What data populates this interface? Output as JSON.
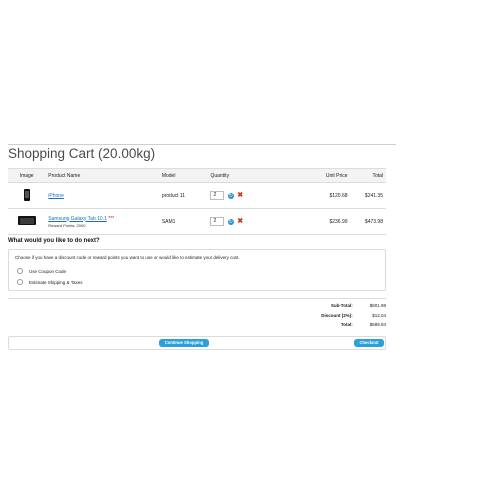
{
  "page": {
    "title": "Shopping Cart  (20.00kg)"
  },
  "cart": {
    "headers": [
      "Image",
      "Product Name",
      "Model",
      "Quantity",
      "Unit Price",
      "Total"
    ],
    "rows": [
      {
        "image_icon": "smartphone-thumbnail",
        "name": "iPhone",
        "reward": "",
        "model": "product 11",
        "qty": "2",
        "unit_price": "$120.68",
        "total": "$241.35"
      },
      {
        "image_icon": "tablet-thumbnail",
        "name": "Samsung Galaxy Tab 10.1",
        "stars": "***",
        "reward": "Reward Points: 2000",
        "model": "SAM1",
        "qty": "2",
        "unit_price": "$236.99",
        "total": "$473.98"
      }
    ],
    "action_icons": [
      "refresh-icon",
      "remove-icon"
    ]
  },
  "next": {
    "heading": "What would you like to do next?",
    "description": "Choose if you have a discount code or reward points you want to use or would like to estimate your delivery cost.",
    "options": [
      "Use Coupon Code",
      "Estimate Shipping & Taxes"
    ]
  },
  "totals": [
    {
      "label": "Sub-Total:",
      "value": "$601.98"
    },
    {
      "label": "Discount (2%):",
      "value": "$12.04"
    },
    {
      "label": "Total:",
      "value": "$589.94"
    }
  ],
  "buttons": {
    "continue": "Continue Shopping",
    "checkout": "Checkout"
  },
  "colors": {
    "button": "#2aa0dc",
    "link": "#1e6fbf",
    "remove": "#d23a1c"
  }
}
